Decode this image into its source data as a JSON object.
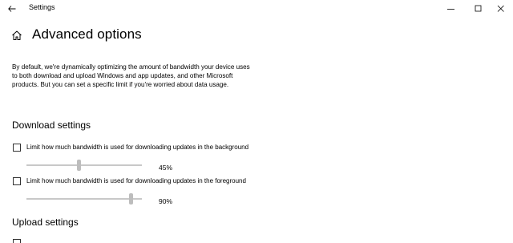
{
  "window": {
    "title": "Settings"
  },
  "header": {
    "page_title": "Advanced options"
  },
  "description": "By default, we're dynamically optimizing the amount of bandwidth your device uses to both download and upload Windows and app updates, and other Microsoft products. But you can set a specific limit if you're worried about data usage.",
  "download_settings": {
    "heading": "Download settings",
    "background": {
      "label": "Limit how much bandwidth is used for downloading updates in the background",
      "checked": false,
      "value_label": "45%",
      "value": 45
    },
    "foreground": {
      "label": "Limit how much bandwidth is used for downloading updates in the foreground",
      "checked": false,
      "value_label": "90%",
      "value": 90
    }
  },
  "upload_settings": {
    "heading": "Upload settings"
  },
  "icons": {
    "back": "back-arrow-icon",
    "home": "home-icon",
    "minimize": "minimize-icon",
    "maximize": "maximize-icon",
    "close": "close-icon"
  },
  "colors": {
    "slider_track": "#c8c8c8",
    "slider_thumb": "#bdbdbd"
  }
}
